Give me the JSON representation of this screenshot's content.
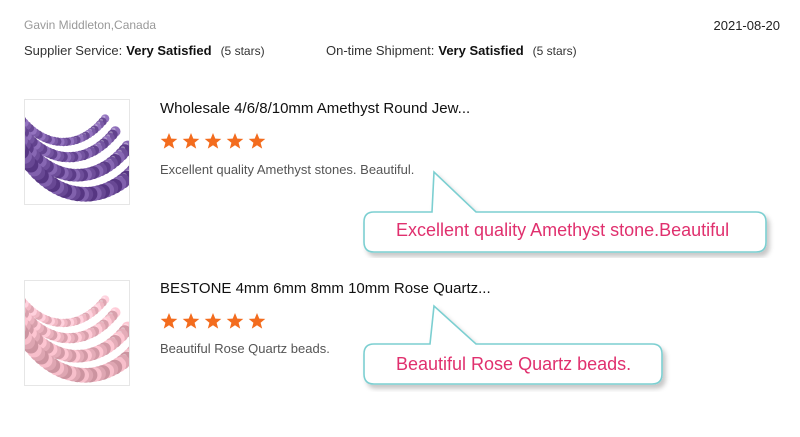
{
  "reviewer": "Gavin Middleton,Canada",
  "date": "2021-08-20",
  "ratings": {
    "supplier_service_label": "Supplier Service:",
    "supplier_service_value": "Very Satisfied",
    "supplier_service_stars": "(5 stars)",
    "shipment_label": "On-time Shipment:",
    "shipment_value": "Very Satisfied",
    "shipment_stars": "(5 stars)"
  },
  "reviews": [
    {
      "title": "Wholesale 4/6/8/10mm Amethyst Round Jew...",
      "rating": 5,
      "comment": "Excellent quality Amethyst stones. Beautiful.",
      "callout": "Excellent quality Amethyst stone.Beautiful",
      "bead_color": "#7a5aa6"
    },
    {
      "title": "BESTONE 4mm 6mm 8mm 10mm Rose Quartz...",
      "rating": 5,
      "comment": "Beautiful Rose Quartz beads.",
      "callout": "Beautiful Rose Quartz beads.",
      "bead_color": "#f0b8c4"
    }
  ],
  "colors": {
    "star": "#f36c1e",
    "callout_border": "#7ccfd1",
    "callout_text": "#e0306e"
  }
}
